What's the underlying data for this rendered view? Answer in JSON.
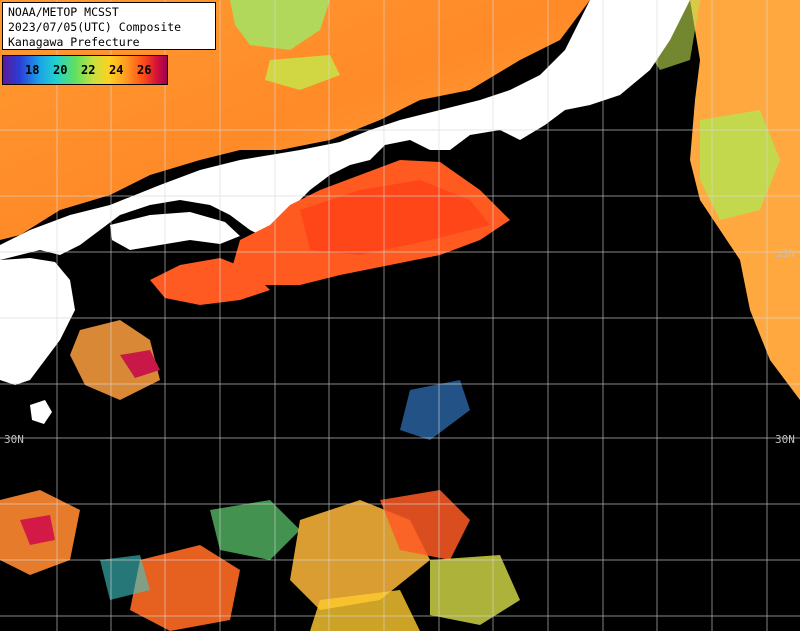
{
  "title": {
    "line1": "NOAA/METOP MCSST",
    "line2": "2023/07/05(UTC) Composite",
    "line3": "Kanagawa Prefecture"
  },
  "legend": {
    "ticks": [
      "18",
      "20",
      "22",
      "24",
      "26"
    ],
    "colors": [
      "#5a1a9a",
      "#2a3cd6",
      "#1aa0e8",
      "#22d0d0",
      "#60e060",
      "#c8e040",
      "#ffd020",
      "#ff9a20",
      "#ff4a18",
      "#d0103a",
      "#a00050"
    ]
  },
  "grid": {
    "lat_labels": {
      "n33_right": "33N",
      "n30_left": "30N",
      "n30_right": "30N"
    }
  },
  "colors": {
    "land": "#ffffff",
    "no_data": "#000000",
    "gridline": "#d8d8d8"
  }
}
